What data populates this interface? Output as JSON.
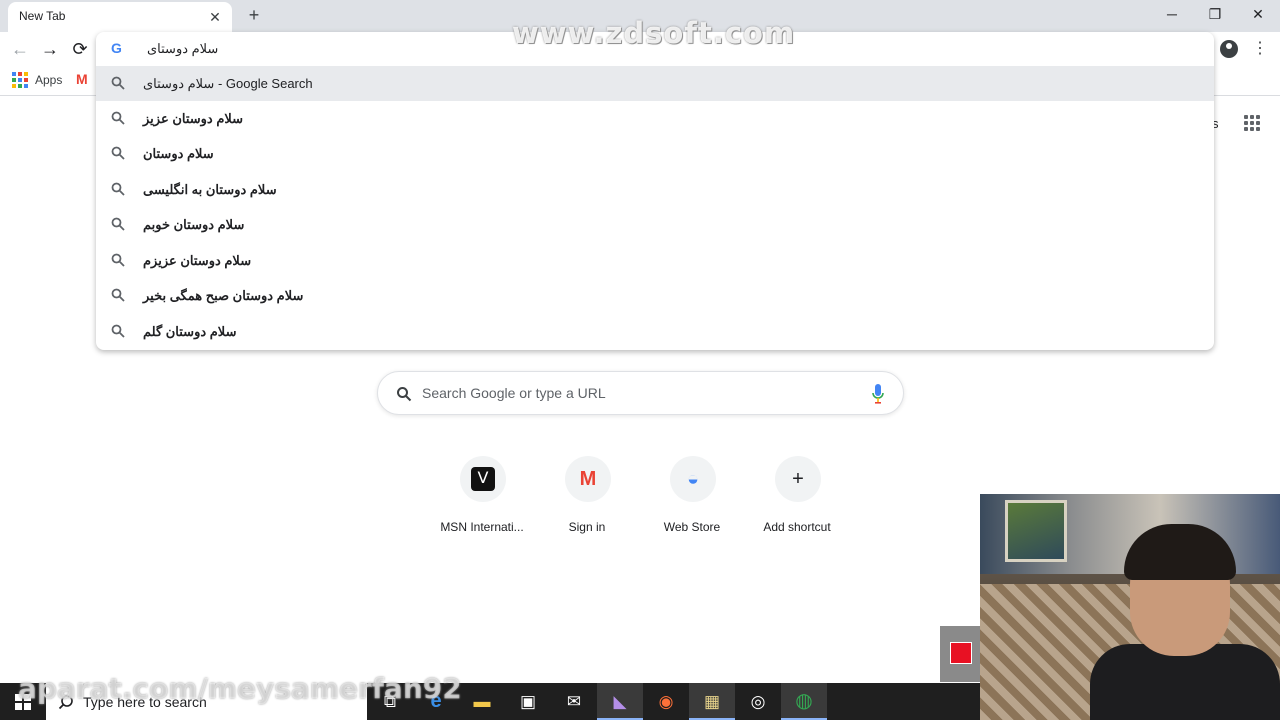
{
  "browser": {
    "tab_title": "New Tab",
    "tab_close": "✕",
    "new_tab": "+",
    "window_controls": {
      "minimize": "─",
      "maximize": "❐",
      "close": "✕"
    }
  },
  "toolbar": {
    "back": "←",
    "forward": "→",
    "reload": "⟳",
    "menu": "⋮"
  },
  "bookmarks": {
    "apps_label": "Apps",
    "gmail_glyph": "M"
  },
  "omnibox": {
    "logo": "G",
    "text": "سلام دوستای",
    "suggestions": [
      {
        "bold": "",
        "normal": "سلام دوستای - Google Search"
      },
      {
        "bold": "سلام دوستان عزیز",
        "normal": ""
      },
      {
        "bold": "سلام دوستان",
        "normal": ""
      },
      {
        "bold": "سلام دوستان به انگلیسی",
        "normal": ""
      },
      {
        "bold": "سلام دوستان خوبم",
        "normal": ""
      },
      {
        "bold": "سلام دوستان عزیزم",
        "normal": ""
      },
      {
        "bold": "سلام دوستان صبح همگی بخیر",
        "normal": ""
      },
      {
        "bold": "سلام دوستان گلم",
        "normal": ""
      }
    ]
  },
  "page": {
    "partial_text": "s",
    "search_placeholder": "Search Google or type a URL",
    "shortcuts": [
      {
        "label": "MSN Internati...",
        "glyph": "Ⅴ",
        "icon": "msn-icon"
      },
      {
        "label": "Sign in",
        "glyph": "M",
        "icon": "gmail-icon"
      },
      {
        "label": "Web Store",
        "glyph": "◒",
        "icon": "web-store-icon"
      },
      {
        "label": "Add shortcut",
        "glyph": "+",
        "icon": "plus-icon"
      }
    ]
  },
  "watermark": {
    "top": "www.zdsoft.com",
    "bottom": "aparat.com/meysamerfan92"
  },
  "taskbar": {
    "search_text": "Type here to search",
    "apps": [
      {
        "glyph": "⧉",
        "name": "task-view-icon"
      },
      {
        "glyph": "e",
        "name": "edge-icon"
      },
      {
        "glyph": "▬",
        "name": "file-explorer-icon"
      },
      {
        "glyph": "▣",
        "name": "store-icon"
      },
      {
        "glyph": "✉",
        "name": "mail-icon"
      },
      {
        "glyph": "◣",
        "name": "visual-studio-icon"
      },
      {
        "glyph": "◉",
        "name": "firefox-icon"
      },
      {
        "glyph": "▦",
        "name": "film-editor-icon"
      },
      {
        "glyph": "◎",
        "name": "recorder-icon"
      },
      {
        "glyph": "◍",
        "name": "chrome-icon"
      }
    ]
  },
  "colors": {
    "accent_blue": "#4285f4",
    "gmail_red": "#ea4335",
    "record_red": "#e81123"
  }
}
